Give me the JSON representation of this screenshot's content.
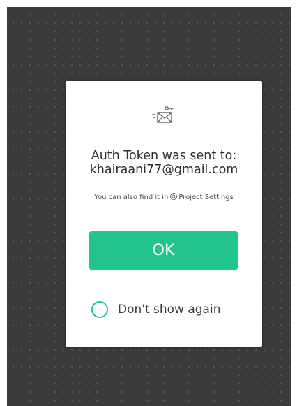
{
  "dialog": {
    "title_line1": "Auth Token was sent to:",
    "title_line2": "khairaani77@gmail.com",
    "hint_prefix": "You can also find it in",
    "hint_link": "Project Settings",
    "ok_label": "OK",
    "checkbox_label": "Don't show again",
    "checkbox_checked": false
  },
  "icons": {
    "mail": "mail-sent-icon",
    "settings": "gear-icon"
  },
  "colors": {
    "accent": "#23c48e",
    "background": "#3a3b3d",
    "dialog": "#ffffff"
  }
}
